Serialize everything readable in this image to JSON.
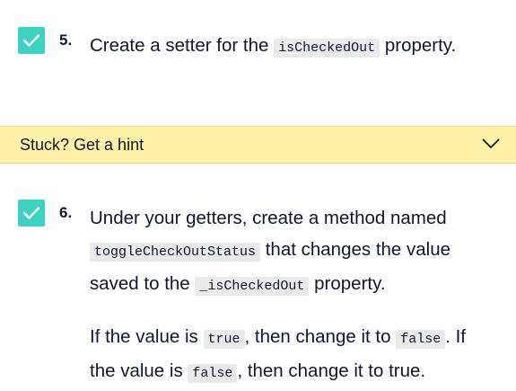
{
  "tasks": [
    {
      "number": "5.",
      "completed": true,
      "text_before": "Create a setter for the",
      "code": "isCheckedOut",
      "text_after": "property."
    },
    {
      "number": "6.",
      "completed": true,
      "text_before": "Under your getters, create a method named",
      "code": "toggleCheckOutStatus",
      "text_mid": "that changes the value saved to the",
      "code2": "_isCheckedOut",
      "text_after": "property.",
      "p2_before": "If the value is",
      "p2_code1": "true",
      "p2_mid1": ", then change it to",
      "p2_code2": "false",
      "p2_mid2": ". If the value is",
      "p2_code3": "false",
      "p2_after": ", then change it to true."
    }
  ],
  "hint": {
    "label": "Stuck? Get a hint",
    "icon": "chevron-down-icon"
  },
  "colors": {
    "checkbox": "#3fd1c2",
    "hint_background": "#fff0a8",
    "text": "#10162f",
    "code_background": "#eaeaea"
  }
}
